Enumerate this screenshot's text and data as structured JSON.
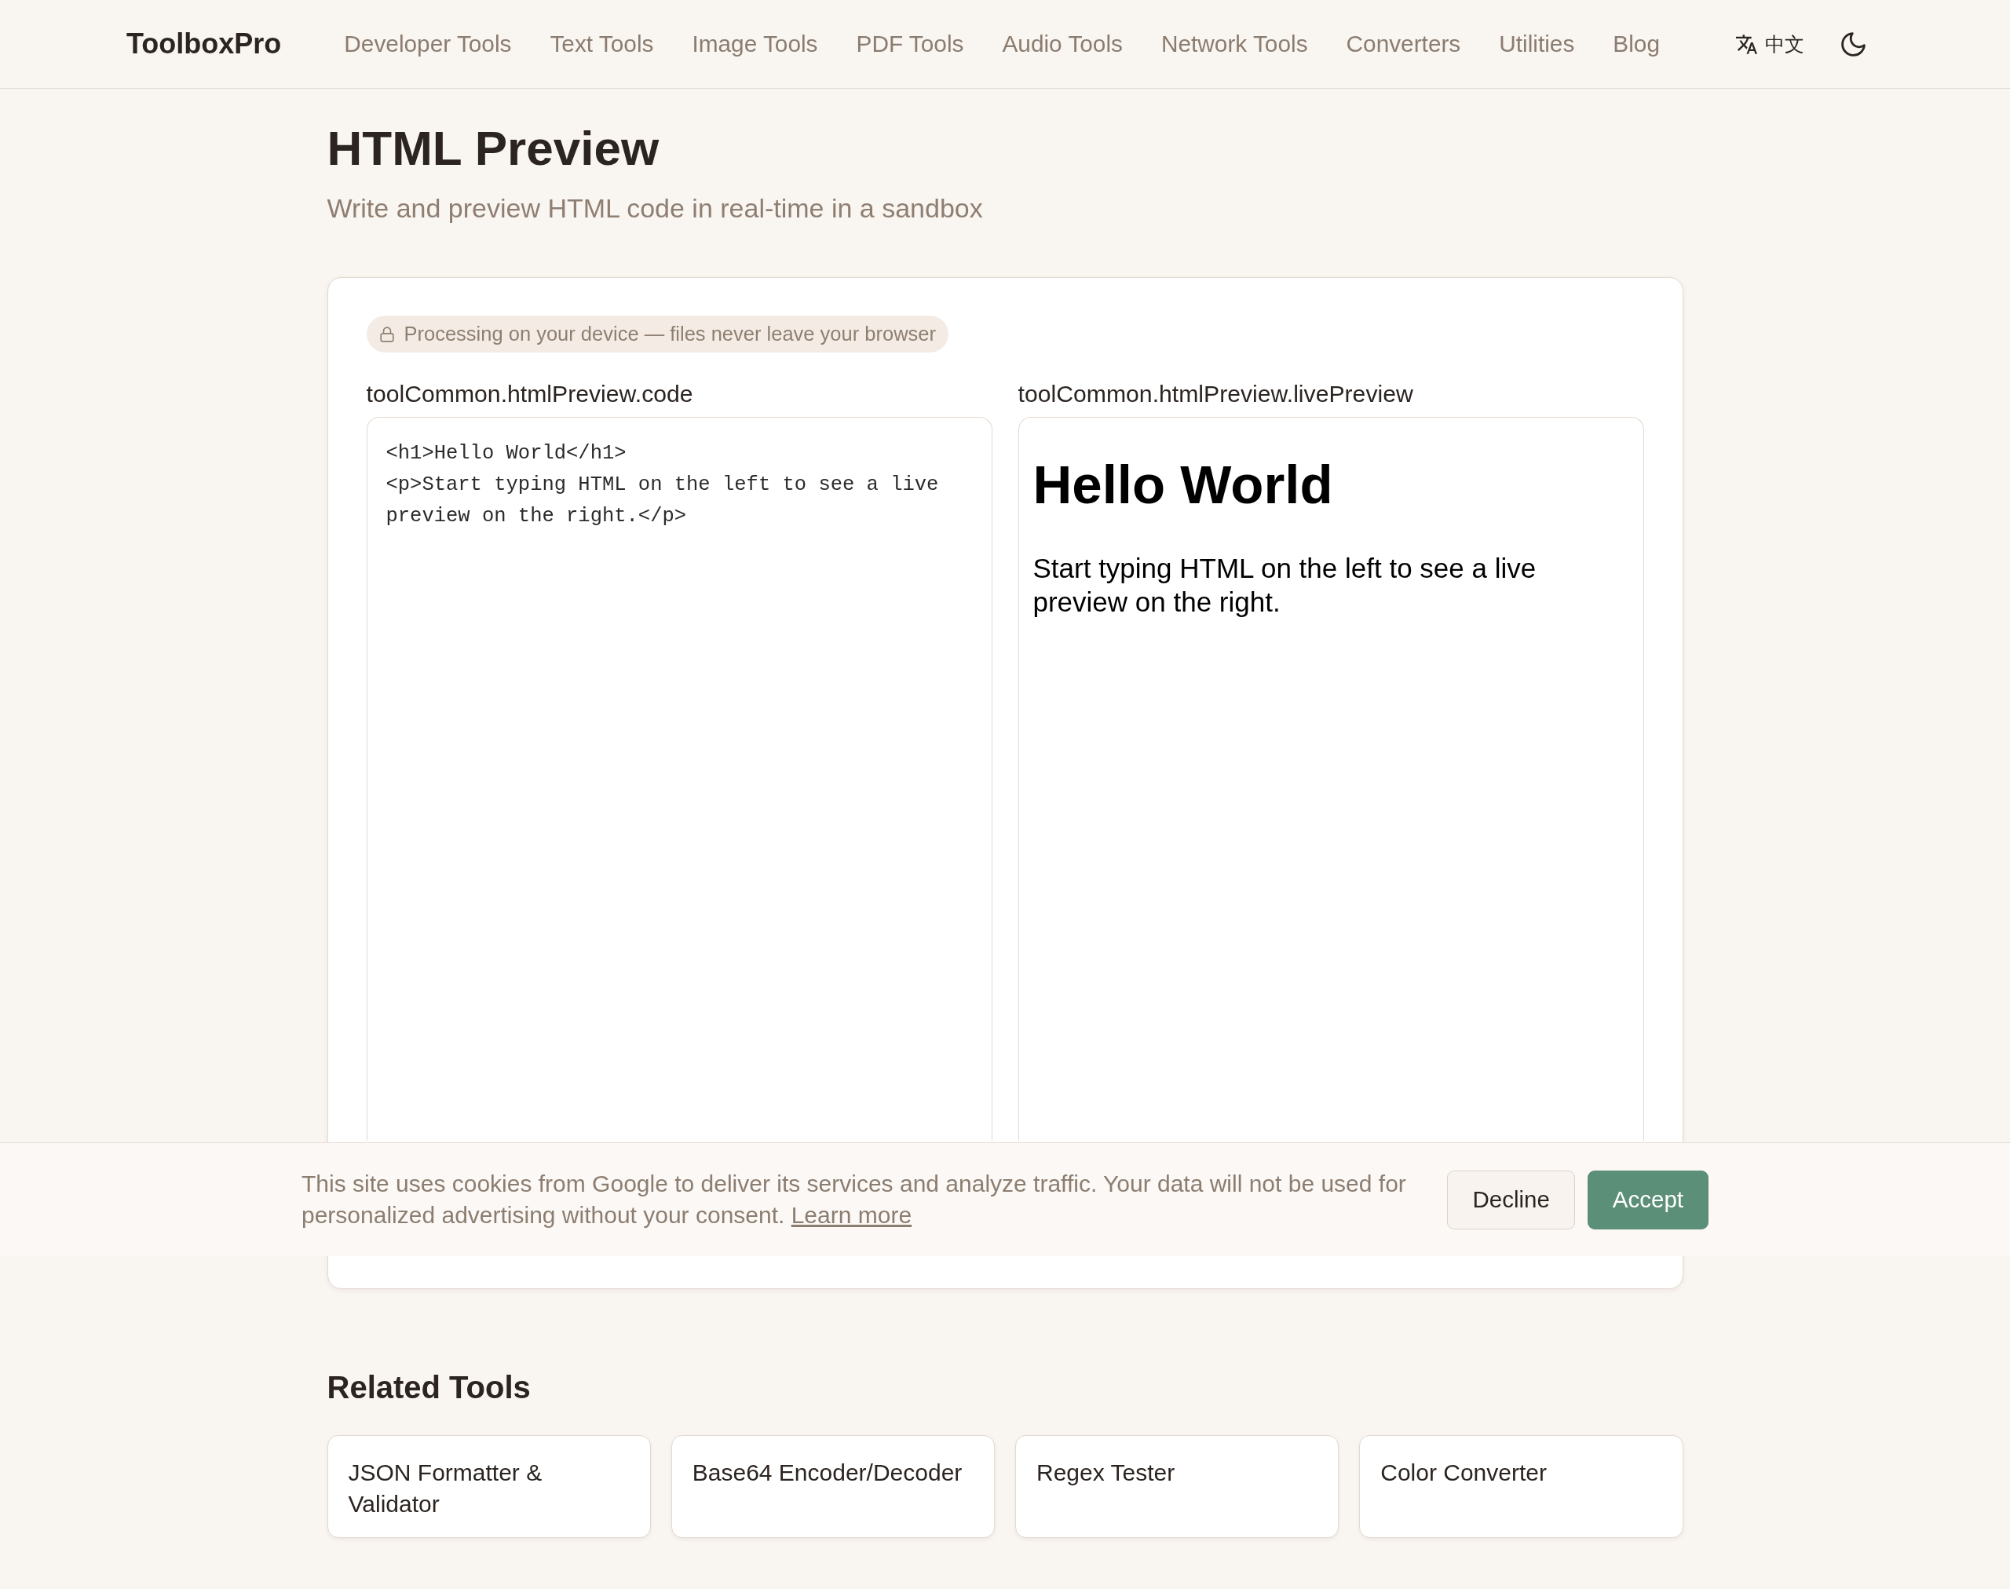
{
  "navbar": {
    "brand": "ToolboxPro",
    "links": [
      "Developer Tools",
      "Text Tools",
      "Image Tools",
      "PDF Tools",
      "Audio Tools",
      "Network Tools",
      "Converters",
      "Utilities",
      "Blog"
    ],
    "language": "中文"
  },
  "header": {
    "title": "HTML Preview",
    "subtitle": "Write and preview HTML code in real-time in a sandbox"
  },
  "tool": {
    "privacy_badge": "Processing on your device — files never leave your browser",
    "editor": {
      "label": "toolCommon.htmlPreview.code",
      "value": "<h1>Hello World</h1>\n<p>Start typing HTML on the left to see a live preview on the right.</p>"
    },
    "preview": {
      "label": "toolCommon.htmlPreview.livePreview",
      "heading": "Hello World",
      "paragraph": "Start typing HTML on the left to see a live preview on the right."
    }
  },
  "related_tools": {
    "title": "Related Tools",
    "items": [
      "JSON Formatter & Validator",
      "Base64 Encoder/Decoder",
      "Regex Tester",
      "Color Converter"
    ]
  },
  "cookie_banner": {
    "text": "This site uses cookies from Google to deliver its services and analyze traffic. Your data will not be used for personalized advertising without your consent.",
    "link": "Learn more",
    "buttons": [
      {
        "label": "Decline",
        "kind": "secondary"
      },
      {
        "label": "Accept",
        "kind": "primary"
      }
    ]
  }
}
